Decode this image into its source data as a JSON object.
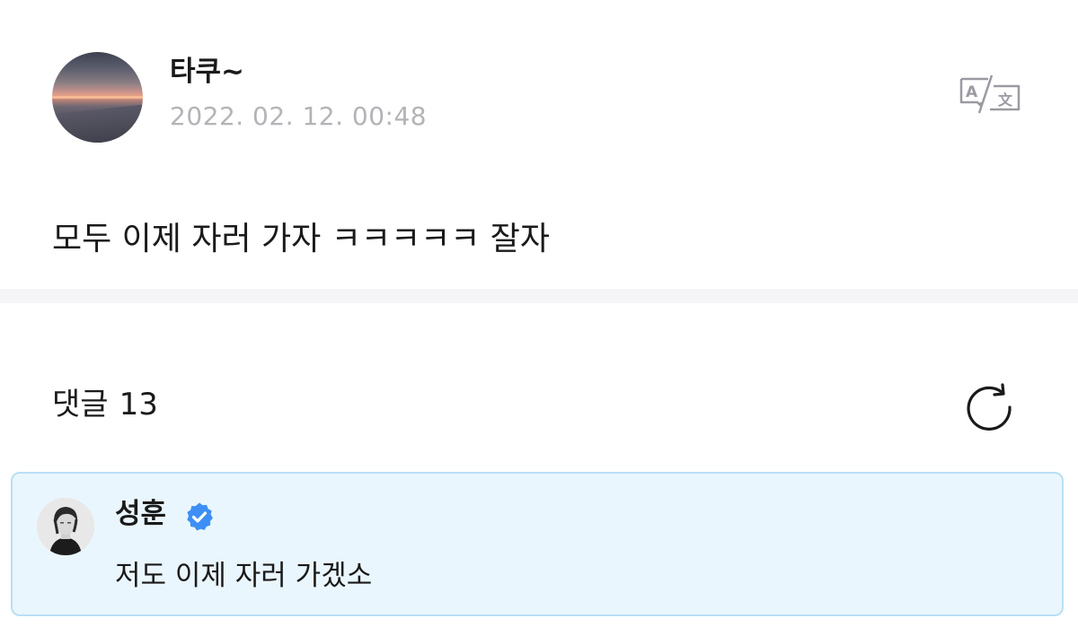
{
  "post": {
    "author_name": "타쿠~",
    "timestamp": "2022. 02. 12. 00:48",
    "body": "모두 이제 자러 가자 ㅋㅋㅋㅋㅋ 잘자",
    "avatar_icon": "sunset-beach-avatar",
    "translate_icon": "translate-icon"
  },
  "comments": {
    "label": "댓글",
    "count": "13",
    "refresh_icon": "refresh-icon",
    "items": [
      {
        "author_name": "성훈",
        "verified": true,
        "text": "저도 이제 자러 가겠소",
        "highlighted": true
      }
    ]
  },
  "colors": {
    "timestamp": "#b3b3b8",
    "divider": "#f5f5f8",
    "highlight_background": "#eaf6fd",
    "highlight_border": "#b9dff4",
    "verified_badge": "#3d8ff5"
  }
}
